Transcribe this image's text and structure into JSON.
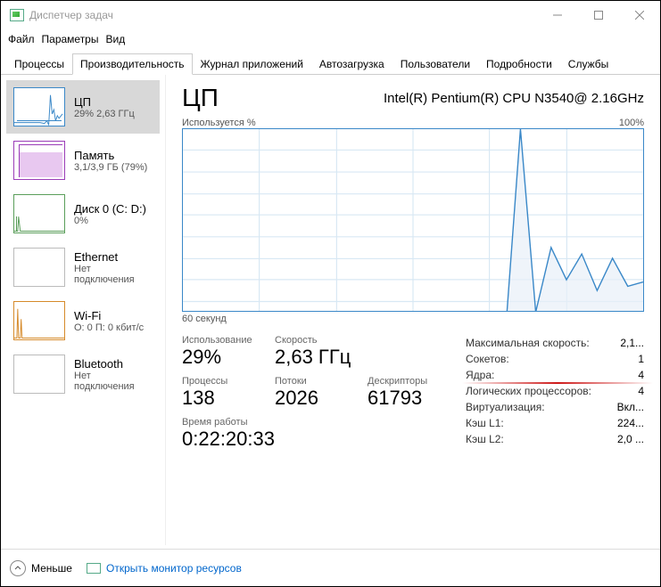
{
  "window": {
    "title": "Диспетчер задач"
  },
  "menu": {
    "file": "Файл",
    "options": "Параметры",
    "view": "Вид"
  },
  "tabs": {
    "processes": "Процессы",
    "performance": "Производительность",
    "app_history": "Журнал приложений",
    "startup": "Автозагрузка",
    "users": "Пользователи",
    "details": "Подробности",
    "services": "Службы"
  },
  "sidebar": {
    "cpu": {
      "label": "ЦП",
      "sub": "29% 2,63 ГГц"
    },
    "memory": {
      "label": "Память",
      "sub": "3,1/3,9 ГБ (79%)"
    },
    "disk": {
      "label": "Диск 0 (C: D:)",
      "sub": "0%"
    },
    "ethernet": {
      "label": "Ethernet",
      "sub": "Нет подключения"
    },
    "wifi": {
      "label": "Wi-Fi",
      "sub": "О: 0 П: 0 кбит/с"
    },
    "bluetooth": {
      "label": "Bluetooth",
      "sub": "Нет подключения"
    }
  },
  "main": {
    "title": "ЦП",
    "cpu_name": "Intel(R) Pentium(R) CPU N3540@ 2.16GHz",
    "chart_top_left": "Используется %",
    "chart_top_right": "100%",
    "chart_bottom": "60 секунд",
    "stats": {
      "utilization": {
        "label": "Использование",
        "value": "29%"
      },
      "speed": {
        "label": "Скорость",
        "value": "2,63 ГГц"
      },
      "processes": {
        "label": "Процессы",
        "value": "138"
      },
      "threads": {
        "label": "Потоки",
        "value": "2026"
      },
      "handles": {
        "label": "Дескрипторы",
        "value": "61793"
      },
      "uptime": {
        "label": "Время работы",
        "value": "0:22:20:33"
      }
    },
    "right": {
      "max_speed": {
        "label": "Максимальная скорость:",
        "value": "2,1..."
      },
      "sockets": {
        "label": "Сокетов:",
        "value": "1"
      },
      "cores": {
        "label": "Ядра:",
        "value": "4"
      },
      "logical": {
        "label": "Логических процессоров:",
        "value": "4"
      },
      "virt": {
        "label": "Виртуализация:",
        "value": "Вкл..."
      },
      "l1": {
        "label": "Кэш L1:",
        "value": "224..."
      },
      "l2": {
        "label": "Кэш L2:",
        "value": "2,0 ..."
      }
    }
  },
  "footer": {
    "less": "Меньше",
    "monitor": "Открыть монитор ресурсов"
  },
  "chart_data": {
    "type": "line",
    "title": "Используется %",
    "xlabel": "60 секунд",
    "ylabel": "%",
    "ylim": [
      0,
      100
    ],
    "x_seconds_ago": [
      60,
      58,
      56,
      54,
      52,
      50,
      48,
      46,
      44,
      42,
      40,
      38,
      36,
      34,
      32,
      30,
      28,
      26,
      24,
      22,
      20,
      18,
      16,
      14,
      12,
      10,
      8,
      6,
      4,
      2,
      0
    ],
    "values": [
      4,
      3,
      4,
      3,
      4,
      3,
      4,
      3,
      4,
      3,
      4,
      3,
      4,
      3,
      4,
      3,
      4,
      5,
      4,
      3,
      4,
      3,
      100,
      15,
      45,
      30,
      42,
      25,
      40,
      27,
      29
    ]
  }
}
